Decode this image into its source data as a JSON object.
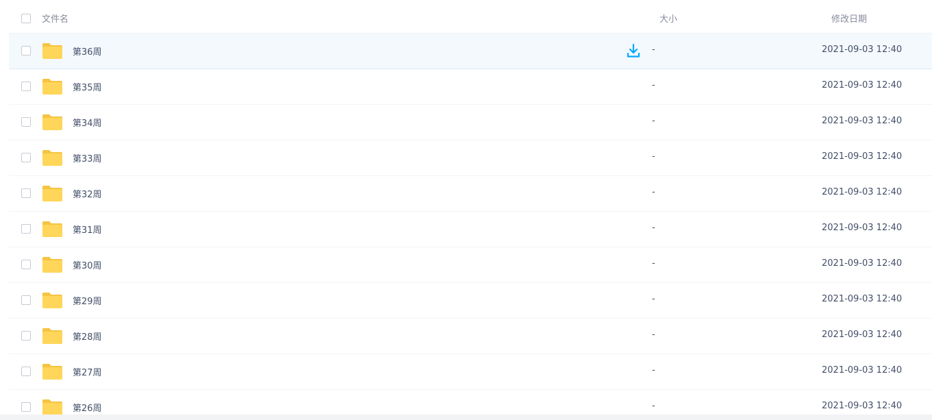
{
  "header": {
    "name_label": "文件名",
    "size_label": "大小",
    "date_label": "修改日期"
  },
  "files": [
    {
      "name": "第36周",
      "size": "-",
      "modified": "2021-09-03 12:40"
    },
    {
      "name": "第35周",
      "size": "-",
      "modified": "2021-09-03 12:40"
    },
    {
      "name": "第34周",
      "size": "-",
      "modified": "2021-09-03 12:40"
    },
    {
      "name": "第33周",
      "size": "-",
      "modified": "2021-09-03 12:40"
    },
    {
      "name": "第32周",
      "size": "-",
      "modified": "2021-09-03 12:40"
    },
    {
      "name": "第31周",
      "size": "-",
      "modified": "2021-09-03 12:40"
    },
    {
      "name": "第30周",
      "size": "-",
      "modified": "2021-09-03 12:40"
    },
    {
      "name": "第29周",
      "size": "-",
      "modified": "2021-09-03 12:40"
    },
    {
      "name": "第28周",
      "size": "-",
      "modified": "2021-09-03 12:40"
    },
    {
      "name": "第27周",
      "size": "-",
      "modified": "2021-09-03 12:40"
    },
    {
      "name": "第26周",
      "size": "-",
      "modified": "2021-09-03 12:40"
    }
  ],
  "icons": {
    "folder": "folder-icon",
    "download": "download-icon"
  },
  "colors": {
    "folder": "#ffd659",
    "folder_back": "#f5c443",
    "accent": "#06a7ff",
    "hover_row": "#f4f9fd"
  }
}
